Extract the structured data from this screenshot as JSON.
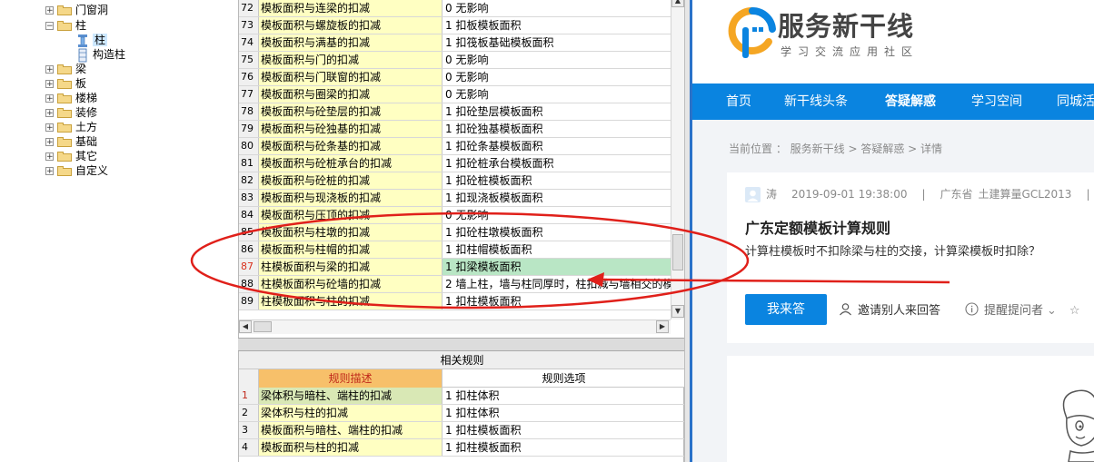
{
  "tree": {
    "items": [
      {
        "label": "门窗洞",
        "expanded": false
      },
      {
        "label": "柱",
        "expanded": true
      },
      {
        "label": "柱",
        "child": true,
        "selected": true
      },
      {
        "label": "构造柱",
        "child": true
      },
      {
        "label": "梁",
        "expanded": false
      },
      {
        "label": "板",
        "expanded": false
      },
      {
        "label": "楼梯",
        "expanded": false
      },
      {
        "label": "装修",
        "expanded": false
      },
      {
        "label": "土方",
        "expanded": false
      },
      {
        "label": "基础",
        "expanded": false
      },
      {
        "label": "其它",
        "expanded": false
      },
      {
        "label": "自定义",
        "expanded": false
      }
    ]
  },
  "grid": {
    "header": {
      "desc": "规则描述",
      "option": "规则选项"
    },
    "rows": [
      {
        "num": "72",
        "desc": "模板面积与连梁的扣减",
        "option": "0  无影响"
      },
      {
        "num": "73",
        "desc": "模板面积与螺旋板的扣减",
        "option": "1 扣板模板面积"
      },
      {
        "num": "74",
        "desc": "模板面积与满基的扣减",
        "option": "1 扣筏板基础模板面积"
      },
      {
        "num": "75",
        "desc": "模板面积与门的扣减",
        "option": "0  无影响"
      },
      {
        "num": "76",
        "desc": "模板面积与门联窗的扣减",
        "option": "0  无影响"
      },
      {
        "num": "77",
        "desc": "模板面积与圈梁的扣减",
        "option": "0  无影响"
      },
      {
        "num": "78",
        "desc": "模板面积与砼垫层的扣减",
        "option": "1 扣砼垫层模板面积"
      },
      {
        "num": "79",
        "desc": "模板面积与砼独基的扣减",
        "option": "1 扣砼独基模板面积"
      },
      {
        "num": "80",
        "desc": "模板面积与砼条基的扣减",
        "option": "1 扣砼条基模板面积"
      },
      {
        "num": "81",
        "desc": "模板面积与砼桩承台的扣减",
        "option": "1 扣砼桩承台模板面积"
      },
      {
        "num": "82",
        "desc": "模板面积与砼桩的扣减",
        "option": "1 扣砼桩模板面积"
      },
      {
        "num": "83",
        "desc": "模板面积与现浇板的扣减",
        "option": "1 扣现浇板模板面积"
      },
      {
        "num": "84",
        "desc": "模板面积与压顶的扣减",
        "option": "0  无影响"
      },
      {
        "num": "85",
        "desc": "模板面积与柱墩的扣减",
        "option": "1 扣砼柱墩模板面积"
      },
      {
        "num": "86",
        "desc": "模板面积与柱帽的扣减",
        "option": "1 扣柱帽模板面积"
      },
      {
        "num": "87",
        "desc": "柱模板面积与梁的扣减",
        "option": "1 扣梁模板面积",
        "highlight": true
      },
      {
        "num": "88",
        "desc": "柱模板面积与砼墙的扣减",
        "option": "2 墙上柱，墙与柱同厚时，柱扣减与墙相交的模"
      },
      {
        "num": "89",
        "desc": "柱模板面积与柱的扣减",
        "option": "1 扣柱模板面积"
      }
    ]
  },
  "related": {
    "title": "相关规则",
    "header": {
      "desc": "规则描述",
      "option": "规则选项"
    },
    "rows": [
      {
        "num": "1",
        "desc": "梁体积与暗柱、端柱的扣减",
        "option": "1 扣柱体积"
      },
      {
        "num": "2",
        "desc": "梁体积与柱的扣减",
        "option": "1 扣柱体积"
      },
      {
        "num": "3",
        "desc": "模板面积与暗柱、端柱的扣减",
        "option": "1 扣柱模板面积"
      },
      {
        "num": "4",
        "desc": "模板面积与柱的扣减",
        "option": "1 扣柱模板面积"
      }
    ]
  },
  "web": {
    "brand": "服务新干线",
    "slogan": "学习交流应用社区",
    "nav": [
      "首页",
      "新干线头条",
      "答疑解惑",
      "学习空间",
      "同城活"
    ],
    "nav_active": "答疑解惑",
    "breadcrumb": "当前位置 ： 服务新干线 > 答疑解惑 > 详情",
    "question": {
      "author": "涛",
      "datetime": "2019-09-01 19:38:00",
      "sep1": "|",
      "region": "广东省",
      "software": "土建算量GCL2013",
      "sep2": "|",
      "title": "广东定额模板计算规则",
      "body": "计算柱模板时不扣除梁与柱的交接，计算梁模板时扣除？"
    },
    "actions": {
      "answer": "我来答",
      "invite": "邀请别人来回答",
      "remind": "提醒提问者"
    },
    "colors": {
      "nav": "#0a84e0",
      "button": "#0a84e0"
    }
  },
  "annotation": {
    "color": "#e0201a",
    "shape": "ellipse-with-arrow"
  }
}
